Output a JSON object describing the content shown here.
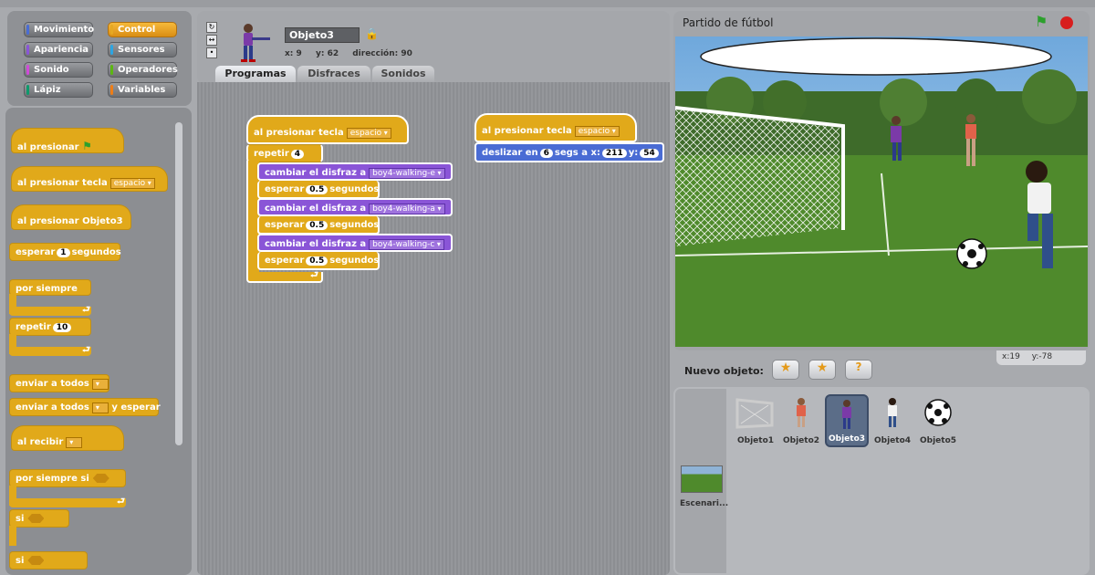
{
  "categories": [
    {
      "label": "Movimiento",
      "color": "#4a6cd4",
      "selected": false
    },
    {
      "label": "Control",
      "color": "#e6a822",
      "selected": true
    },
    {
      "label": "Apariencia",
      "color": "#8a55d7",
      "selected": false
    },
    {
      "label": "Sensores",
      "color": "#2ca5e2",
      "selected": false
    },
    {
      "label": "Sonido",
      "color": "#cf4ad9",
      "selected": false
    },
    {
      "label": "Operadores",
      "color": "#5cb712",
      "selected": false
    },
    {
      "label": "Lápiz",
      "color": "#0e9a6c",
      "selected": false
    },
    {
      "label": "Variables",
      "color": "#ee7d16",
      "selected": false
    }
  ],
  "palette": {
    "green_flag": "al presionar",
    "key_press": "al presionar tecla",
    "key_value": "espacio",
    "click_obj": "al presionar",
    "click_obj_name": "Objeto3",
    "wait": "esperar",
    "wait_num": "1",
    "wait_unit": "segundos",
    "forever": "por siempre",
    "repeat": "repetir",
    "repeat_num": "10",
    "broadcast": "enviar a todos",
    "broadcast_wait_a": "enviar a todos",
    "broadcast_wait_b": "y esperar",
    "receive": "al recibir",
    "forever_if": "por siempre si",
    "if1": "si",
    "if2": "si"
  },
  "sprite_info": {
    "name": "Objeto3",
    "x_label": "x:",
    "x": "9",
    "y_label": "y:",
    "y": "62",
    "dir_label": "dirección:",
    "dir": "90"
  },
  "tabs": [
    "Programas",
    "Disfraces",
    "Sonidos"
  ],
  "script1": {
    "hat": "al presionar tecla",
    "key": "espacio",
    "repeat": "repetir",
    "repeat_num": "4",
    "switch_label": "cambiar el disfraz a",
    "costume1": "boy4-walking-e",
    "costume2": "boy4-walking-a",
    "costume3": "boy4-walking-c",
    "wait": "esperar",
    "wait_num": "0.5",
    "wait_unit": "segundos"
  },
  "script2": {
    "hat": "al presionar tecla",
    "key": "espacio",
    "glide_a": "deslizar en",
    "glide_secs": "6",
    "glide_b": "segs a x:",
    "glide_x": "211",
    "glide_c": "y:",
    "glide_y": "54"
  },
  "stage": {
    "title": "Partido de fútbol",
    "mouse_x_label": "x:",
    "mouse_x": "19",
    "mouse_y_label": "y:",
    "mouse_y": "-78"
  },
  "new_sprite_label": "Nuevo objeto:",
  "sprites": [
    "Objeto1",
    "Objeto2",
    "Objeto3",
    "Objeto4",
    "Objeto5"
  ],
  "stage_thumb_label": "Escenari..."
}
